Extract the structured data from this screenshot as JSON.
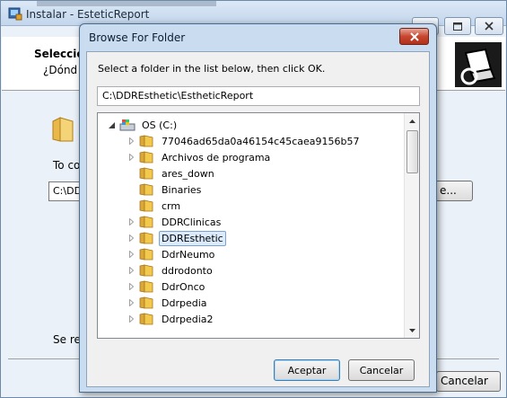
{
  "installer": {
    "title": "Instalar - EsteticReport",
    "heading": "Selecció",
    "subheading": "¿Dónd",
    "body_label": "To con",
    "path_value": "C:\\DD",
    "browse_label": "e...",
    "space_label": "Se req",
    "cancel_label": "Cancelar"
  },
  "dialog": {
    "title": "Browse For Folder",
    "instruction": "Select a folder in the list below, then click OK.",
    "path": "C:\\DDREsthetic\\EstheticReport",
    "ok_label": "Aceptar",
    "cancel_label": "Cancelar",
    "tree": [
      {
        "label": "OS (C:)",
        "type": "drive",
        "expander": "open"
      },
      {
        "label": "77046ad65da0a46154c45caea9156b57",
        "type": "folder",
        "expander": "closed"
      },
      {
        "label": "Archivos de programa",
        "type": "folder",
        "expander": "closed"
      },
      {
        "label": "ares_down",
        "type": "folder",
        "expander": "none"
      },
      {
        "label": "Binaries",
        "type": "folder",
        "expander": "none"
      },
      {
        "label": "crm",
        "type": "folder",
        "expander": "none"
      },
      {
        "label": "DDRClinicas",
        "type": "folder",
        "expander": "closed"
      },
      {
        "label": "DDREsthetic",
        "type": "folder",
        "expander": "closed",
        "selected": true
      },
      {
        "label": "DdrNeumo",
        "type": "folder",
        "expander": "closed"
      },
      {
        "label": "ddrodonto",
        "type": "folder",
        "expander": "closed"
      },
      {
        "label": "DdrOnco",
        "type": "folder",
        "expander": "closed"
      },
      {
        "label": "Ddrpedia",
        "type": "folder",
        "expander": "closed"
      },
      {
        "label": "Ddrpedia2",
        "type": "folder",
        "expander": "closed"
      }
    ]
  },
  "colors": {
    "selection_fill": "#dcebfc",
    "selection_border": "#7da2ce",
    "folder_yellow": "#f2c94c",
    "close_red": "#c7462f"
  }
}
